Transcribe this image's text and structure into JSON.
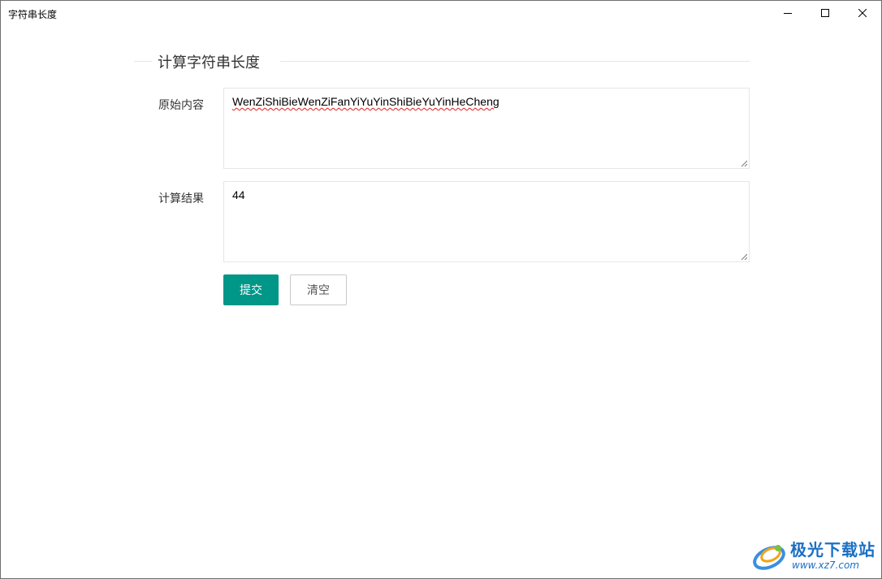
{
  "window": {
    "title": "字符串长度"
  },
  "form": {
    "legend": "计算字符串长度",
    "source_label": "原始内容",
    "source_value": "WenZiShiBieWenZiFanYiYuYinShiBieYuYinHeCheng",
    "result_label": "计算结果",
    "result_value": "44",
    "submit_label": "提交",
    "clear_label": "清空"
  },
  "colors": {
    "primary": "#009688",
    "border": "#e6e6e6",
    "watermark": "#1b6fc4"
  },
  "watermark": {
    "name": "极光下载站",
    "url": "www.xz7.com"
  }
}
